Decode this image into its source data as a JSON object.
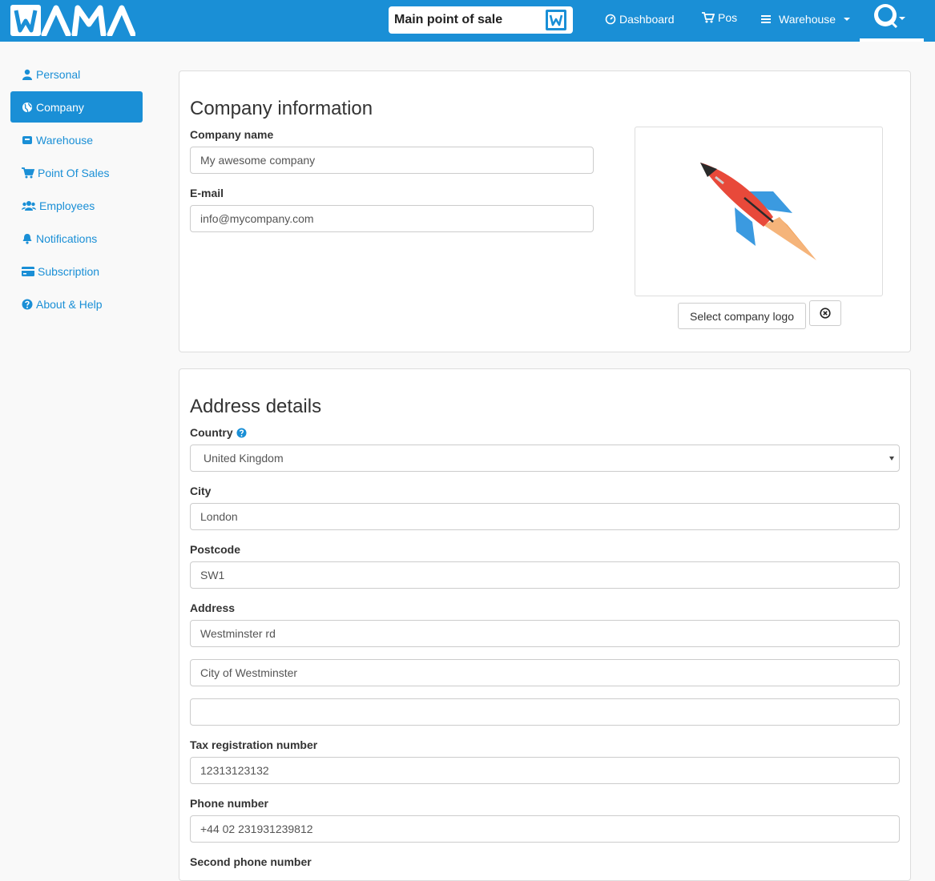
{
  "brand": {
    "logo_text": "WAMA",
    "color": "#1a8fd6"
  },
  "header": {
    "pos_selector": {
      "value": "Main point of sale",
      "badge": "W"
    },
    "nav": {
      "dashboard": "Dashboard",
      "pos": "Pos",
      "warehouse": "Warehouse"
    }
  },
  "sidebar": {
    "items": [
      {
        "label": "Personal",
        "icon": "user-icon"
      },
      {
        "label": "Company",
        "icon": "globe-icon",
        "active": true
      },
      {
        "label": "Warehouse",
        "icon": "box-icon"
      },
      {
        "label": "Point Of Sales",
        "icon": "cart-icon"
      },
      {
        "label": "Employees",
        "icon": "users-icon"
      },
      {
        "label": "Notifications",
        "icon": "bell-icon"
      },
      {
        "label": "Subscription",
        "icon": "credit-card-icon"
      },
      {
        "label": "About & Help",
        "icon": "question-circle-icon"
      }
    ]
  },
  "company": {
    "title": "Company information",
    "name_label": "Company name",
    "name_value": "My awesome company",
    "email_label": "E-mail",
    "email_value": "info@mycompany.com",
    "select_logo_label": "Select company logo"
  },
  "address": {
    "title": "Address details",
    "country_label": "Country",
    "country_value": "United Kingdom",
    "city_label": "City",
    "city_value": "London",
    "postcode_label": "Postcode",
    "postcode_value": "SW1",
    "address_label": "Address",
    "address_line1": "Westminster rd",
    "address_line2": "City of Westminster",
    "address_line3": "",
    "tax_label": "Tax registration number",
    "tax_value": "12313123132",
    "phone_label": "Phone number",
    "phone_value": "+44 02 231931239812",
    "second_phone_label": "Second phone number"
  }
}
